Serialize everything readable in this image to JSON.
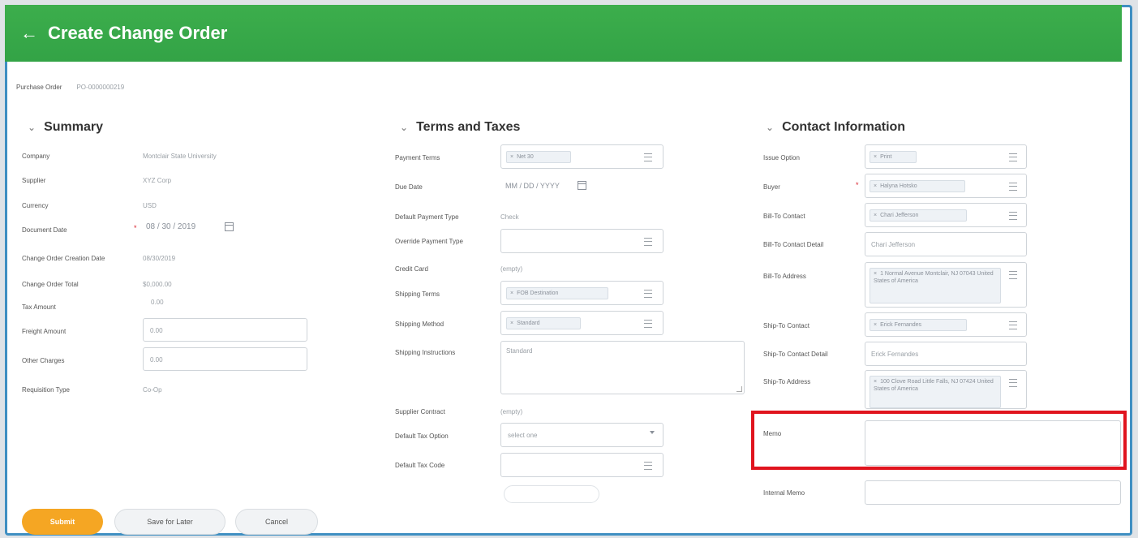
{
  "header": {
    "back_icon": "←",
    "title": "Create Change Order",
    "color": "#33a346"
  },
  "purchase_order": {
    "label": "Purchase Order",
    "value": "PO-0000000219"
  },
  "summary": {
    "title": "Summary",
    "chevron": "⌄",
    "company_label": "Company",
    "company_value": "Montclair State University",
    "supplier_label": "Supplier",
    "supplier_value": "XYZ Corp",
    "currency_label": "Currency",
    "currency_value": "USD",
    "document_date_label": "Document Date",
    "document_date_value": "08 / 30 / 2019",
    "change_order_creation_date_label": "Change Order Creation Date",
    "change_order_creation_date_value": "08/30/2019",
    "change_order_total_label": "Change Order Total",
    "change_order_total_value": "$0,000.00",
    "tax_amount_label": "Tax Amount",
    "tax_amount_value": "0.00",
    "freight_amount_label": "Freight Amount",
    "freight_amount_value": "0.00",
    "other_charges_label": "Other Charges",
    "other_charges_value": "0.00",
    "requisition_type_label": "Requisition Type",
    "requisition_type_value": "Co-Op"
  },
  "terms": {
    "title": "Terms and Taxes",
    "chevron": "⌄",
    "payment_terms_label": "Payment Terms",
    "payment_terms_value": "Net 30",
    "due_date_label": "Due Date",
    "due_date_value": "MM / DD / YYYY",
    "default_payment_type_label": "Default Payment Type",
    "default_payment_type_value": "Check",
    "override_payment_type_label": "Override Payment Type",
    "credit_card_label": "Credit Card",
    "credit_card_value": "(empty)",
    "shipping_terms_label": "Shipping Terms",
    "shipping_terms_value": "FOB Destination",
    "shipping_method_label": "Shipping Method",
    "shipping_method_value": "Standard",
    "shipping_instructions_label": "Shipping Instructions",
    "shipping_instructions_value": "Standard",
    "supplier_contract_label": "Supplier Contract",
    "supplier_contract_value": "(empty)",
    "default_tax_option_label": "Default Tax Option",
    "default_tax_option_placeholder": "select one",
    "default_tax_code_label": "Default Tax Code"
  },
  "contact": {
    "title": "Contact Information",
    "chevron": "⌄",
    "issue_option_label": "Issue Option",
    "issue_option_value": "Print",
    "buyer_label": "Buyer",
    "buyer_value": "Halyna Hotsko",
    "bill_to_contact_label": "Bill-To Contact",
    "bill_to_contact_value": "Chari Jefferson",
    "bill_to_contact_detail_label": "Bill-To Contact Detail",
    "bill_to_contact_detail_value": "Chari Jefferson",
    "bill_to_address_label": "Bill-To Address",
    "bill_to_address_value": "1 Normal Avenue Montclair, NJ 07043 United States of America",
    "ship_to_contact_label": "Ship-To Contact",
    "ship_to_contact_value": "Erick Fernandes",
    "ship_to_contact_detail_label": "Ship-To Contact Detail",
    "ship_to_contact_detail_value": "Erick Fernandes",
    "ship_to_address_label": "Ship-To Address",
    "ship_to_address_value": "100 Clove Road Little Falls, NJ 07424 United States of America",
    "memo_label": "Memo",
    "internal_memo_label": "Internal Memo"
  },
  "buttons": {
    "submit": "Submit",
    "save_for_later": "Save for Later",
    "cancel": "Cancel"
  },
  "colors": {
    "accent": "#f5a623",
    "highlight": "#e0141e",
    "required": "#d9232e"
  },
  "icons": {
    "pill_remove": "×",
    "required_marker": "*"
  }
}
